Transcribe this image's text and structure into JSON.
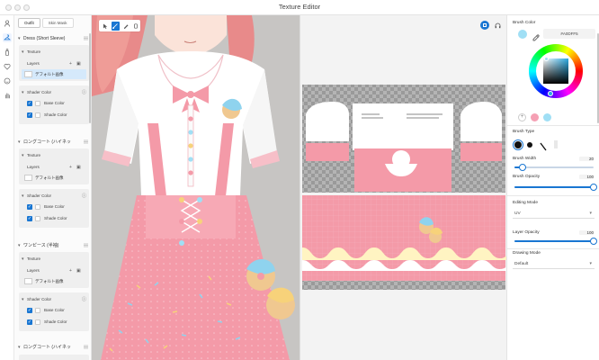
{
  "window": {
    "title": "Texture Editor"
  },
  "panel_tabs": [
    {
      "label": "Outfit"
    },
    {
      "label": "Skin Mask"
    }
  ],
  "panel": {
    "groups": [
      {
        "name": "Dress (Short Sleeve)",
        "texture_label": "Texture",
        "layers_label": "Layers",
        "layer_name": "デフォルト画像",
        "shader_label": "Shader Color",
        "base_label": "Base Color",
        "shade_label": "Shade Color"
      },
      {
        "name": "ロングコート (ハイネッ",
        "texture_label": "Texture",
        "layers_label": "Layers",
        "layer_name": "デフォルト画像",
        "shader_label": "Shader Color",
        "base_label": "Base Color",
        "shade_label": "Shade Color"
      },
      {
        "name": "ワンピース (半袖)",
        "texture_label": "Texture",
        "layers_label": "Layers",
        "layer_name": "デフォルト画像",
        "shader_label": "Shader Color",
        "base_label": "Base Color",
        "shade_label": "Shade Color"
      },
      {
        "name": "ロングコート (ハイネッ"
      }
    ]
  },
  "right_panel": {
    "brush_color_label": "Brush Color",
    "hex": "#A0DFF5",
    "brush_type_label": "Brush Type",
    "brush_width_label": "Brush Width",
    "brush_width_value": "20",
    "brush_width_fraction": 0.1,
    "brush_opacity_label": "Brush Opacity",
    "brush_opacity_value": "100",
    "editing_mode_label": "Editing Mode",
    "editing_mode_value": "UV",
    "layer_opacity_label": "Layer Opacity",
    "layer_opacity_value": "100",
    "drawing_mode_label": "Drawing Mode",
    "drawing_mode_value": "Default"
  },
  "colors": {
    "accent": "#1976d2",
    "brush": "#a0dff5",
    "swatch_pink": "#f5a0b4",
    "swatch_blue": "#a0dff5",
    "dress_pink": "#f29aa8",
    "lace_white": "#ffffff"
  },
  "icons": {
    "rail": [
      "person-icon",
      "hanger-icon",
      "bottle-icon",
      "heart-icon",
      "face-icon",
      "hand-icon"
    ],
    "toolbox": [
      "select-tool-icon",
      "brush-tool-icon",
      "pen-tool-icon",
      "eraser-tool-icon"
    ]
  }
}
